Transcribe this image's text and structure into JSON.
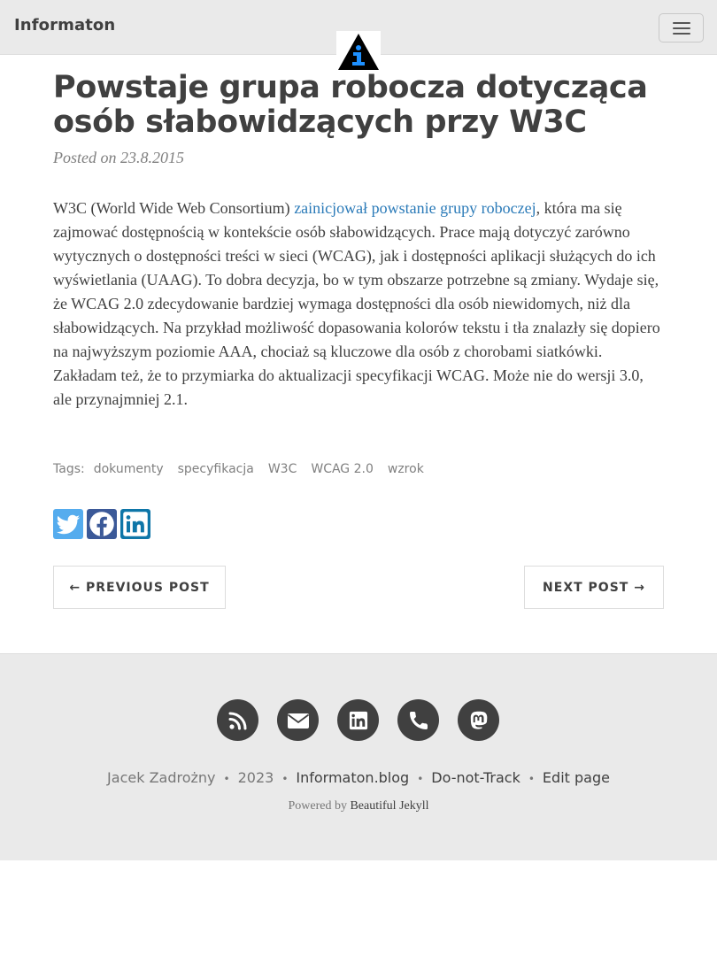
{
  "navbar": {
    "brand": "Informaton",
    "toggle_icon": "hamburger-menu-icon",
    "avatar_icon": "info-triangle-logo"
  },
  "post": {
    "title": "Powstaje grupa robocza dotycząca osób słabowidzących przy W3C",
    "meta": "Posted on 23.8.2015",
    "body_before_link": "W3C (World Wide Web Consortium) ",
    "body_link": "zainicjował powstanie grupy roboczej",
    "body_after_link": ", która ma się zajmować dostępnością w kontekście osób słabowidzących. Prace mają dotyczyć zarówno wytycznych o dostępności treści w sieci (WCAG), jak i dostępności aplikacji służących do ich wyświetlania (UAAG). To dobra decyzja, bo w tym obszarze potrzebne są zmiany. Wydaje się, że WCAG 2.0 zdecydowanie bardziej wymaga dostępności dla osób niewidomych, niż dla słabowidzących. Na przykład możliwość dopasowania kolorów tekstu i tła znalazły się dopiero na najwyższym poziomie AAA, chociaż są kluczowe dla osób z chorobami siatkówki. Zakładam też, że to przymiarka do aktualizacji specyfikacji WCAG. Może nie do wersji 3.0, ale przynajmniej 2.1.",
    "link_color": "#2a7ab8"
  },
  "tags": {
    "label": "Tags:",
    "items": [
      "dokumenty",
      "specyfikacja",
      "W3C",
      "WCAG 2.0",
      "wzrok"
    ]
  },
  "share": {
    "buttons": [
      {
        "icon": "twitter-icon",
        "color": "#55acee"
      },
      {
        "icon": "facebook-icon",
        "color": "#3b5998"
      },
      {
        "icon": "linkedin-icon",
        "color": "#0e76a8"
      }
    ]
  },
  "pager": {
    "prev_label": "← PREVIOUS POST",
    "next_label": "NEXT POST →"
  },
  "footer": {
    "icons": [
      "rss-icon",
      "envelope-icon",
      "linkedin-icon",
      "phone-icon",
      "mastodon-icon"
    ],
    "author": "Jacek Zadrożny",
    "year": "2023",
    "site": "Informaton.blog",
    "dnt": "Do-not-Track",
    "edit": "Edit page",
    "powered_prefix": "Powered by ",
    "powered_link": "Beautiful Jekyll",
    "separator": "•"
  }
}
